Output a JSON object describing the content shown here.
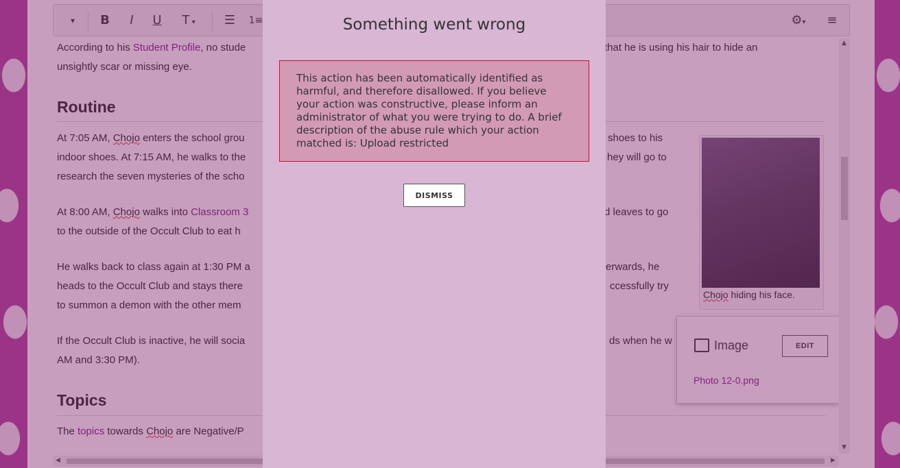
{
  "toolbar": {
    "dropdown_icon": "chevron-down",
    "bold": "B",
    "italic": "I",
    "underline": "U",
    "text_style": "T",
    "bullet_list_icon": "bullet-list",
    "numbered_list_icon": "numbered-list",
    "settings_icon": "gear",
    "menu_icon": "hamburger"
  },
  "article": {
    "para1_a": "According to his ",
    "para1_link": "Student Profile",
    "para1_b": ", no stude",
    "para1_c": "that he is using his hair to hide an",
    "para1_line2": "unsightly scar or missing eye.",
    "heading_routine": "Routine",
    "r1_l1_a": "At 7:05 AM, ",
    "r1_name": "Chojo",
    "r1_l1_b": " enters the school grou",
    "r1_l1_c": "shoes to his",
    "r1_l2_a": "indoor shoes. At 7:15 AM, he walks to the",
    "r1_l2_c": "hey will go to",
    "r1_l3": "research the seven mysteries of the scho",
    "r2_l1_a": "At 8:00 AM, ",
    "r2_name": "Chojo",
    "r2_l1_b": " walks into ",
    "r2_link": "Classroom 3",
    "r2_l1_c": "d leaves to go",
    "r2_l2": "to the outside of the Occult Club to eat h",
    "r3_l1_a": "He walks back to class again at 1:30 PM a",
    "r3_l1_c": "erwards, he",
    "r3_l2_a": "heads to the Occult Club and stays there",
    "r3_l2_c": "ccessfully try",
    "r3_l3": "to summon a demon with the other mem",
    "r4_l1_a": "If the Occult Club is inactive, he will socia",
    "r4_l1_c": "ds when he w",
    "r4_l2": "AM and 3:30 PM).",
    "heading_topics": "Topics",
    "t1_a": "The ",
    "t1_link": "topics",
    "t1_b": " towards ",
    "t1_name": "Chojo",
    "t1_c": " are Negative/P"
  },
  "figure": {
    "caption_name": "Chojo",
    "caption_rest": " hiding his face."
  },
  "image_popup": {
    "title": "Image",
    "edit_label": "EDIT",
    "filename": "Photo 12-0.png"
  },
  "dialog": {
    "title": "Something went wrong",
    "message": "This action has been automatically identified as harmful, and therefore disallowed. If you believe your action was constructive, please inform an administrator of what you were trying to do. A brief description of the abuse rule which your action matched is: Upload restricted",
    "dismiss_label": "DISMISS"
  },
  "colors": {
    "overlay": "#82286e",
    "dialog_bg": "#d8b6d4",
    "error_bg": "#d39ab6",
    "error_border": "#c8102e",
    "link": "#7a1f84"
  }
}
